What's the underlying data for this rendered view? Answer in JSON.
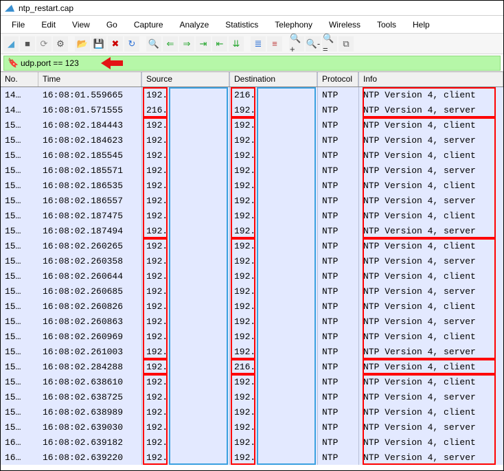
{
  "title": "ntp_restart.cap",
  "menus": [
    "File",
    "Edit",
    "View",
    "Go",
    "Capture",
    "Analyze",
    "Statistics",
    "Telephony",
    "Wireless",
    "Tools",
    "Help"
  ],
  "toolbar_icons": [
    {
      "name": "fin-icon",
      "glyph": "◢",
      "color": "#4da3d4"
    },
    {
      "name": "stop-icon",
      "glyph": "■",
      "color": "#555"
    },
    {
      "name": "restart-icon",
      "glyph": "⟳",
      "color": "#888"
    },
    {
      "name": "options-icon",
      "glyph": "⚙",
      "color": "#555"
    },
    {
      "name": "sep"
    },
    {
      "name": "open-icon",
      "glyph": "📂",
      "color": "#b07d2b"
    },
    {
      "name": "save-icon",
      "glyph": "💾",
      "color": "#888"
    },
    {
      "name": "close-icon",
      "glyph": "✖",
      "color": "#c00"
    },
    {
      "name": "reload-icon",
      "glyph": "↻",
      "color": "#2a6fd6"
    },
    {
      "name": "sep"
    },
    {
      "name": "find-icon",
      "glyph": "🔍",
      "color": "#333"
    },
    {
      "name": "back-icon",
      "glyph": "⇐",
      "color": "#23a52c"
    },
    {
      "name": "fwd-icon",
      "glyph": "⇒",
      "color": "#23a52c"
    },
    {
      "name": "goto-icon",
      "glyph": "⇥",
      "color": "#23a52c"
    },
    {
      "name": "first-icon",
      "glyph": "⇤",
      "color": "#23a52c"
    },
    {
      "name": "last-icon",
      "glyph": "⇊",
      "color": "#23a52c"
    },
    {
      "name": "sep"
    },
    {
      "name": "auto-scroll-icon",
      "glyph": "≣",
      "color": "#2a6fd6"
    },
    {
      "name": "colorize-icon",
      "glyph": "≡",
      "color": "#c04040"
    },
    {
      "name": "sep"
    },
    {
      "name": "zoom-in-icon",
      "glyph": "🔍+",
      "color": "#333"
    },
    {
      "name": "zoom-out-icon",
      "glyph": "🔍-",
      "color": "#333"
    },
    {
      "name": "zoom-reset-icon",
      "glyph": "🔍=",
      "color": "#333"
    },
    {
      "name": "resize-cols-icon",
      "glyph": "⧉",
      "color": "#555"
    }
  ],
  "filter": {
    "value": "udp.port == 123"
  },
  "columns": [
    "No.",
    "Time",
    "Source",
    "Destination",
    "Protocol",
    "Info"
  ],
  "packets": [
    {
      "no": "14…",
      "time": "16:08:01.559665",
      "src": "192.",
      "dst": "216.",
      "prot": "NTP",
      "info": "NTP Version 4, client"
    },
    {
      "no": "14…",
      "time": "16:08:01.571555",
      "src": "216.",
      "dst": "192.",
      "prot": "NTP",
      "info": "NTP Version 4, server"
    },
    {
      "no": "15…",
      "time": "16:08:02.184443",
      "src": "192.",
      "dst": "192.",
      "prot": "NTP",
      "info": "NTP Version 4, client"
    },
    {
      "no": "15…",
      "time": "16:08:02.184623",
      "src": "192.",
      "dst": "192.",
      "prot": "NTP",
      "info": "NTP Version 4, server"
    },
    {
      "no": "15…",
      "time": "16:08:02.185545",
      "src": "192.",
      "dst": "192.",
      "prot": "NTP",
      "info": "NTP Version 4, client"
    },
    {
      "no": "15…",
      "time": "16:08:02.185571",
      "src": "192.",
      "dst": "192.",
      "prot": "NTP",
      "info": "NTP Version 4, server"
    },
    {
      "no": "15…",
      "time": "16:08:02.186535",
      "src": "192.",
      "dst": "192.",
      "prot": "NTP",
      "info": "NTP Version 4, client"
    },
    {
      "no": "15…",
      "time": "16:08:02.186557",
      "src": "192.",
      "dst": "192.",
      "prot": "NTP",
      "info": "NTP Version 4, server"
    },
    {
      "no": "15…",
      "time": "16:08:02.187475",
      "src": "192.",
      "dst": "192.",
      "prot": "NTP",
      "info": "NTP Version 4, client"
    },
    {
      "no": "15…",
      "time": "16:08:02.187494",
      "src": "192.",
      "dst": "192.",
      "prot": "NTP",
      "info": "NTP Version 4, server"
    },
    {
      "no": "15…",
      "time": "16:08:02.260265",
      "src": "192.",
      "dst": "192.",
      "prot": "NTP",
      "info": "NTP Version 4, client"
    },
    {
      "no": "15…",
      "time": "16:08:02.260358",
      "src": "192.",
      "dst": "192.",
      "prot": "NTP",
      "info": "NTP Version 4, server"
    },
    {
      "no": "15…",
      "time": "16:08:02.260644",
      "src": "192.",
      "dst": "192.",
      "prot": "NTP",
      "info": "NTP Version 4, client"
    },
    {
      "no": "15…",
      "time": "16:08:02.260685",
      "src": "192.",
      "dst": "192.",
      "prot": "NTP",
      "info": "NTP Version 4, server"
    },
    {
      "no": "15…",
      "time": "16:08:02.260826",
      "src": "192.",
      "dst": "192.",
      "prot": "NTP",
      "info": "NTP Version 4, client"
    },
    {
      "no": "15…",
      "time": "16:08:02.260863",
      "src": "192.",
      "dst": "192.",
      "prot": "NTP",
      "info": "NTP Version 4, server"
    },
    {
      "no": "15…",
      "time": "16:08:02.260969",
      "src": "192.",
      "dst": "192.",
      "prot": "NTP",
      "info": "NTP Version 4, client"
    },
    {
      "no": "15…",
      "time": "16:08:02.261003",
      "src": "192.",
      "dst": "192.",
      "prot": "NTP",
      "info": "NTP Version 4, server"
    },
    {
      "no": "15…",
      "time": "16:08:02.284288",
      "src": "192.",
      "dst": "216.",
      "prot": "NTP",
      "info": "NTP Version 4, client"
    },
    {
      "no": "15…",
      "time": "16:08:02.638610",
      "src": "192.",
      "dst": "192.",
      "prot": "NTP",
      "info": "NTP Version 4, client"
    },
    {
      "no": "15…",
      "time": "16:08:02.638725",
      "src": "192.",
      "dst": "192.",
      "prot": "NTP",
      "info": "NTP Version 4, server"
    },
    {
      "no": "15…",
      "time": "16:08:02.638989",
      "src": "192.",
      "dst": "192.",
      "prot": "NTP",
      "info": "NTP Version 4, client"
    },
    {
      "no": "15…",
      "time": "16:08:02.639030",
      "src": "192.",
      "dst": "192.",
      "prot": "NTP",
      "info": "NTP Version 4, server"
    },
    {
      "no": "16…",
      "time": "16:08:02.639182",
      "src": "192.",
      "dst": "192.",
      "prot": "NTP",
      "info": "NTP Version 4, client"
    },
    {
      "no": "16…",
      "time": "16:08:02.639220",
      "src": "192.",
      "dst": "192.",
      "prot": "NTP",
      "info": "NTP Version 4, server"
    }
  ],
  "annotations": {
    "red_boxes_info_groups": [
      [
        0,
        1
      ],
      [
        2,
        9
      ],
      [
        10,
        17
      ],
      [
        18,
        18
      ],
      [
        19,
        24
      ]
    ],
    "red_boxes_src_groups": [
      [
        0,
        1
      ],
      [
        2,
        9
      ],
      [
        10,
        17
      ],
      [
        18,
        18
      ],
      [
        19,
        24
      ]
    ],
    "red_boxes_dst_groups": [
      [
        0,
        1
      ],
      [
        2,
        9
      ],
      [
        10,
        17
      ],
      [
        18,
        18
      ],
      [
        19,
        24
      ]
    ]
  }
}
